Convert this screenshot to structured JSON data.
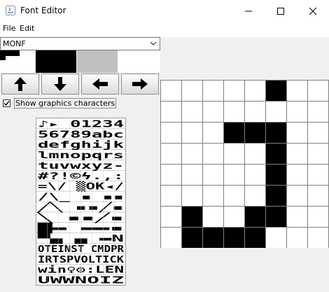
{
  "window": {
    "title": "Font Editor",
    "minimize_icon": "minimize-icon",
    "maximize_icon": "maximize-icon",
    "close_icon": "close-icon"
  },
  "menu": {
    "items": [
      "File",
      "Edit"
    ]
  },
  "font_select": {
    "value": "MONF"
  },
  "swatches": {
    "colors": [
      "#000000",
      "#000000",
      "#c0c0c0",
      "#ffffff"
    ]
  },
  "nav_buttons": [
    {
      "name": "move-up",
      "icon": "arrow-up-icon"
    },
    {
      "name": "move-down",
      "icon": "arrow-down-icon"
    },
    {
      "name": "move-left",
      "icon": "arrow-left-icon"
    },
    {
      "name": "move-right",
      "icon": "arrow-right-icon"
    }
  ],
  "show_graphics": {
    "label": "Show graphics characters",
    "checked": true
  },
  "char_map": {
    "rows": [
      "♪▸ 01234",
      "56789abc",
      "defghijk",
      "lmnopqrs",
      "tuvwxyz-",
      "#?!©ϟ.,:",
      "=\\/ ▒OK◂/",
      "/\\_ ▪ ▪▪",
      "╱╲ ▪▪╱▪",
      "╲ ▪▪╱▪ ",
      "█▬ ▬▬▪ ",
      "▀▄ ▄ ▬N",
      "OTEINST CMDPR",
      "IRTSPVOLTICK",
      "win♀⚙:LEN",
      "UWWNOIZ"
    ]
  },
  "glyph_editor": {
    "pixels": [
      [
        0,
        0,
        0,
        0,
        0,
        1,
        0,
        0
      ],
      [
        0,
        0,
        0,
        0,
        0,
        0,
        0,
        0
      ],
      [
        0,
        0,
        0,
        1,
        1,
        1,
        0,
        0
      ],
      [
        0,
        0,
        0,
        0,
        0,
        1,
        0,
        0
      ],
      [
        0,
        0,
        0,
        0,
        0,
        1,
        0,
        0
      ],
      [
        0,
        0,
        0,
        0,
        0,
        1,
        0,
        0
      ],
      [
        0,
        1,
        0,
        0,
        1,
        1,
        0,
        0
      ],
      [
        0,
        1,
        1,
        1,
        1,
        0,
        0,
        0
      ]
    ]
  }
}
